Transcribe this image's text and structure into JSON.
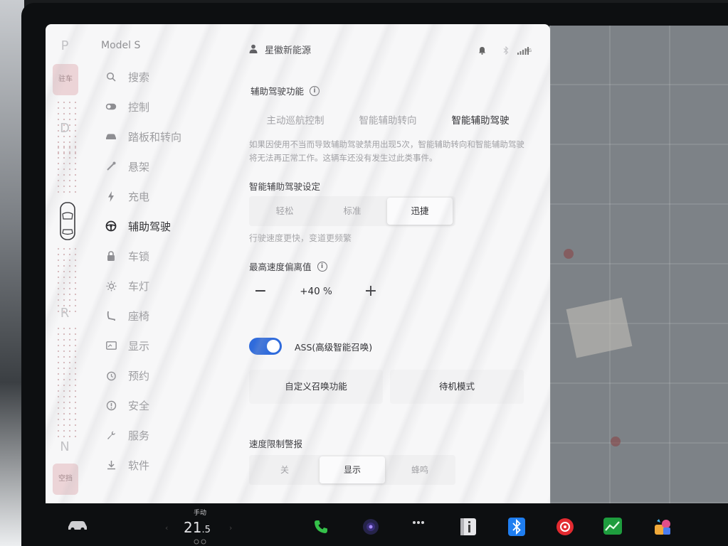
{
  "gear": {
    "letters": [
      "P",
      "D",
      "R",
      "N"
    ],
    "park_label": "驻车",
    "neutral_label": "空挡"
  },
  "sidebar": {
    "model_name": "Model S",
    "items": [
      {
        "label": "搜索",
        "icon": "search-icon"
      },
      {
        "label": "控制",
        "icon": "toggle-icon"
      },
      {
        "label": "踏板和转向",
        "icon": "car-icon"
      },
      {
        "label": "悬架",
        "icon": "suspension-icon"
      },
      {
        "label": "充电",
        "icon": "lightning-icon"
      },
      {
        "label": "辅助驾驶",
        "icon": "steering-wheel-icon",
        "active": true
      },
      {
        "label": "车锁",
        "icon": "lock-icon"
      },
      {
        "label": "车灯",
        "icon": "light-icon"
      },
      {
        "label": "座椅",
        "icon": "seat-icon"
      },
      {
        "label": "显示",
        "icon": "display-icon"
      },
      {
        "label": "预约",
        "icon": "clock-icon"
      },
      {
        "label": "安全",
        "icon": "alert-icon"
      },
      {
        "label": "服务",
        "icon": "wrench-icon"
      },
      {
        "label": "软件",
        "icon": "download-icon"
      }
    ]
  },
  "header": {
    "user_name": "星徽新能源",
    "network": "4G"
  },
  "autopilot": {
    "features_title": "辅助驾驶功能",
    "feature_tabs": [
      "主动巡航控制",
      "智能辅助转向",
      "智能辅助驾驶"
    ],
    "selected_feature": "智能辅助驾驶",
    "warning_text": "如果因使用不当而导致辅助驾驶禁用出现5次，智能辅助转向和智能辅助驾驶将无法再正常工作。这辆车还没有发生过此类事件。",
    "settings_title": "智能辅助驾驶设定",
    "modes": [
      "轻松",
      "标准",
      "迅捷"
    ],
    "selected_mode": "迅捷",
    "mode_hint": "行驶速度更快，变道更频繁",
    "offset_title": "最高速度偏离值",
    "offset_value": "+40 %",
    "minus_label": "−",
    "plus_label": "+",
    "ass_label": "ASS(高级智能召唤)",
    "ass_enabled": true,
    "summon_buttons": [
      "自定义召唤功能",
      "待机模式"
    ],
    "speed_limit_title": "速度限制警报",
    "speed_limit_options": [
      "关",
      "显示",
      "蜂鸣"
    ],
    "speed_limit_selected": "显示"
  },
  "taskbar": {
    "climate_mode": "手动",
    "temperature_main": "21",
    "temperature_decimal": ".5"
  },
  "colors": {
    "accent": "#2f6bdc",
    "panel_bg": "#f7f7f8",
    "park_tag": "#ecd4d7"
  }
}
